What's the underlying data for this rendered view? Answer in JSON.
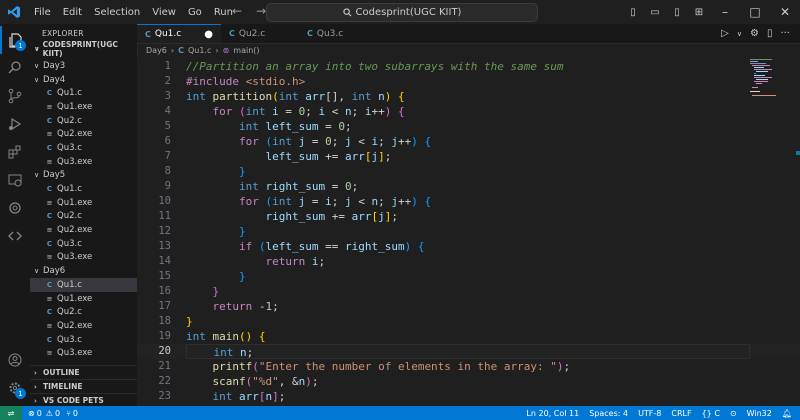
{
  "menu": [
    "File",
    "Edit",
    "Selection",
    "View",
    "Go",
    "Run"
  ],
  "title": "Codesprint(UGC KIIT)",
  "explorer": {
    "heading": "EXPLORER",
    "project": "CODESPRINT(UGC KIIT)",
    "tree": [
      {
        "type": "folder",
        "label": "Day3",
        "expanded": true
      },
      {
        "type": "folder",
        "label": "Day4",
        "expanded": true
      },
      {
        "type": "file",
        "label": "Qu1.c",
        "kind": "c"
      },
      {
        "type": "file",
        "label": "Qu1.exe",
        "kind": "exe"
      },
      {
        "type": "file",
        "label": "Qu2.c",
        "kind": "c"
      },
      {
        "type": "file",
        "label": "Qu2.exe",
        "kind": "exe"
      },
      {
        "type": "file",
        "label": "Qu3.c",
        "kind": "c"
      },
      {
        "type": "file",
        "label": "Qu3.exe",
        "kind": "exe"
      },
      {
        "type": "folder",
        "label": "Day5",
        "expanded": true
      },
      {
        "type": "file",
        "label": "Qu1.c",
        "kind": "c"
      },
      {
        "type": "file",
        "label": "Qu1.exe",
        "kind": "exe"
      },
      {
        "type": "file",
        "label": "Qu2.c",
        "kind": "c"
      },
      {
        "type": "file",
        "label": "Qu2.exe",
        "kind": "exe"
      },
      {
        "type": "file",
        "label": "Qu3.c",
        "kind": "c"
      },
      {
        "type": "file",
        "label": "Qu3.exe",
        "kind": "exe"
      },
      {
        "type": "folder",
        "label": "Day6",
        "expanded": true
      },
      {
        "type": "file",
        "label": "Qu1.c",
        "kind": "c",
        "selected": true
      },
      {
        "type": "file",
        "label": "Qu1.exe",
        "kind": "exe"
      },
      {
        "type": "file",
        "label": "Qu2.c",
        "kind": "c"
      },
      {
        "type": "file",
        "label": "Qu2.exe",
        "kind": "exe"
      },
      {
        "type": "file",
        "label": "Qu3.c",
        "kind": "c"
      },
      {
        "type": "file",
        "label": "Qu3.exe",
        "kind": "exe"
      }
    ],
    "sections": [
      "OUTLINE",
      "TIMELINE",
      "VS CODE PETS"
    ]
  },
  "tabs": [
    {
      "label": "Qu1.c",
      "active": true,
      "modified": true
    },
    {
      "label": "Qu2.c",
      "active": false
    },
    {
      "label": "Qu3.c",
      "active": false
    }
  ],
  "breadcrumb": {
    "folder": "Day6",
    "file": "Qu1.c",
    "symbol": "main()"
  },
  "editor": {
    "current_line": 20,
    "lines": [
      {
        "n": 1,
        "t": [
          [
            "cmt",
            "//Partition an array into two subarrays with the same sum"
          ]
        ]
      },
      {
        "n": 2,
        "t": [
          [
            "pre",
            "#include "
          ],
          [
            "inc",
            "<stdio.h>"
          ]
        ]
      },
      {
        "n": 3,
        "t": [
          [
            "kw",
            "int "
          ],
          [
            "fn",
            "partition"
          ],
          [
            "br1",
            "("
          ],
          [
            "kw",
            "int "
          ],
          [
            "var",
            "arr"
          ],
          [
            "pl",
            "[], "
          ],
          [
            "kw",
            "int "
          ],
          [
            "var",
            "n"
          ],
          [
            "br1",
            ")"
          ],
          [
            "pl",
            " "
          ],
          [
            "br1",
            "{"
          ]
        ]
      },
      {
        "n": 4,
        "t": [
          [
            "pl",
            "    "
          ],
          [
            "ctrl",
            "for "
          ],
          [
            "br2",
            "("
          ],
          [
            "kw",
            "int "
          ],
          [
            "var",
            "i"
          ],
          [
            "pl",
            " = "
          ],
          [
            "num",
            "0"
          ],
          [
            "pl",
            "; "
          ],
          [
            "var",
            "i"
          ],
          [
            "pl",
            " < "
          ],
          [
            "var",
            "n"
          ],
          [
            "pl",
            "; "
          ],
          [
            "var",
            "i"
          ],
          [
            "pl",
            "++"
          ],
          [
            "br2",
            ")"
          ],
          [
            "pl",
            " "
          ],
          [
            "br2",
            "{"
          ]
        ]
      },
      {
        "n": 5,
        "t": [
          [
            "pl",
            "        "
          ],
          [
            "kw",
            "int "
          ],
          [
            "var",
            "left_sum"
          ],
          [
            "pl",
            " = "
          ],
          [
            "num",
            "0"
          ],
          [
            "pl",
            ";"
          ]
        ]
      },
      {
        "n": 6,
        "t": [
          [
            "pl",
            "        "
          ],
          [
            "ctrl",
            "for "
          ],
          [
            "br3",
            "("
          ],
          [
            "kw",
            "int "
          ],
          [
            "var",
            "j"
          ],
          [
            "pl",
            " = "
          ],
          [
            "num",
            "0"
          ],
          [
            "pl",
            "; "
          ],
          [
            "var",
            "j"
          ],
          [
            "pl",
            " < "
          ],
          [
            "var",
            "i"
          ],
          [
            "pl",
            "; "
          ],
          [
            "var",
            "j"
          ],
          [
            "pl",
            "++"
          ],
          [
            "br3",
            ")"
          ],
          [
            "pl",
            " "
          ],
          [
            "br3",
            "{"
          ]
        ]
      },
      {
        "n": 7,
        "t": [
          [
            "pl",
            "            "
          ],
          [
            "var",
            "left_sum"
          ],
          [
            "pl",
            " += "
          ],
          [
            "var",
            "arr"
          ],
          [
            "br1",
            "["
          ],
          [
            "var",
            "j"
          ],
          [
            "br1",
            "]"
          ],
          [
            "pl",
            ";"
          ]
        ]
      },
      {
        "n": 8,
        "t": [
          [
            "pl",
            "        "
          ],
          [
            "br3",
            "}"
          ]
        ]
      },
      {
        "n": 9,
        "t": [
          [
            "pl",
            "        "
          ],
          [
            "kw",
            "int "
          ],
          [
            "var",
            "right_sum"
          ],
          [
            "pl",
            " = "
          ],
          [
            "num",
            "0"
          ],
          [
            "pl",
            ";"
          ]
        ]
      },
      {
        "n": 10,
        "t": [
          [
            "pl",
            "        "
          ],
          [
            "ctrl",
            "for "
          ],
          [
            "br3",
            "("
          ],
          [
            "kw",
            "int "
          ],
          [
            "var",
            "j"
          ],
          [
            "pl",
            " = "
          ],
          [
            "var",
            "i"
          ],
          [
            "pl",
            "; "
          ],
          [
            "var",
            "j"
          ],
          [
            "pl",
            " < "
          ],
          [
            "var",
            "n"
          ],
          [
            "pl",
            "; "
          ],
          [
            "var",
            "j"
          ],
          [
            "pl",
            "++"
          ],
          [
            "br3",
            ")"
          ],
          [
            "pl",
            " "
          ],
          [
            "br3",
            "{"
          ]
        ]
      },
      {
        "n": 11,
        "t": [
          [
            "pl",
            "            "
          ],
          [
            "var",
            "right_sum"
          ],
          [
            "pl",
            " += "
          ],
          [
            "var",
            "arr"
          ],
          [
            "br1",
            "["
          ],
          [
            "var",
            "j"
          ],
          [
            "br1",
            "]"
          ],
          [
            "pl",
            ";"
          ]
        ]
      },
      {
        "n": 12,
        "t": [
          [
            "pl",
            "        "
          ],
          [
            "br3",
            "}"
          ]
        ]
      },
      {
        "n": 13,
        "t": [
          [
            "pl",
            "        "
          ],
          [
            "ctrl",
            "if "
          ],
          [
            "br3",
            "("
          ],
          [
            "var",
            "left_sum"
          ],
          [
            "pl",
            " == "
          ],
          [
            "var",
            "right_sum"
          ],
          [
            "br3",
            ")"
          ],
          [
            "pl",
            " "
          ],
          [
            "br3",
            "{"
          ]
        ]
      },
      {
        "n": 14,
        "t": [
          [
            "pl",
            "            "
          ],
          [
            "ctrl",
            "return "
          ],
          [
            "var",
            "i"
          ],
          [
            "pl",
            ";"
          ]
        ]
      },
      {
        "n": 15,
        "t": [
          [
            "pl",
            "        "
          ],
          [
            "br3",
            "}"
          ]
        ]
      },
      {
        "n": 16,
        "t": [
          [
            "pl",
            "    "
          ],
          [
            "br2",
            "}"
          ]
        ]
      },
      {
        "n": 17,
        "t": [
          [
            "pl",
            "    "
          ],
          [
            "ctrl",
            "return "
          ],
          [
            "pl",
            "-"
          ],
          [
            "num",
            "1"
          ],
          [
            "pl",
            ";"
          ]
        ]
      },
      {
        "n": 18,
        "t": [
          [
            "br1",
            "}"
          ]
        ]
      },
      {
        "n": 19,
        "t": [
          [
            "kw",
            "int "
          ],
          [
            "fn",
            "main"
          ],
          [
            "br1",
            "()"
          ],
          [
            "pl",
            " "
          ],
          [
            "br1",
            "{"
          ]
        ]
      },
      {
        "n": 20,
        "t": [
          [
            "pl",
            "    "
          ],
          [
            "kw",
            "int "
          ],
          [
            "var",
            "n"
          ],
          [
            "pl",
            ";"
          ]
        ]
      },
      {
        "n": 21,
        "t": [
          [
            "pl",
            "    "
          ],
          [
            "fn",
            "printf"
          ],
          [
            "br2",
            "("
          ],
          [
            "str",
            "\"Enter the number of elements in the array: \""
          ],
          [
            "br2",
            ")"
          ],
          [
            "pl",
            ";"
          ]
        ]
      },
      {
        "n": 22,
        "t": [
          [
            "pl",
            "    "
          ],
          [
            "fn",
            "scanf"
          ],
          [
            "br2",
            "("
          ],
          [
            "str",
            "\"%d\""
          ],
          [
            "pl",
            ", &"
          ],
          [
            "var",
            "n"
          ],
          [
            "br2",
            ")"
          ],
          [
            "pl",
            ";"
          ]
        ]
      },
      {
        "n": 23,
        "t": [
          [
            "pl",
            "    "
          ],
          [
            "kw",
            "int "
          ],
          [
            "var",
            "arr"
          ],
          [
            "br2",
            "["
          ],
          [
            "var",
            "n"
          ],
          [
            "br2",
            "]"
          ],
          [
            "pl",
            ";"
          ]
        ]
      }
    ]
  },
  "status": {
    "errors": "0",
    "warnings": "0",
    "ports": "0",
    "position": "Ln 20, Col 11",
    "spaces": "Spaces: 4",
    "encoding": "UTF-8",
    "eol": "CRLF",
    "language": "C",
    "platform": "Win32"
  },
  "colors": {
    "accent": "#0078d4",
    "status_bar": "#0078d4",
    "remote": "#16825d",
    "background": "#1f1f1f"
  }
}
